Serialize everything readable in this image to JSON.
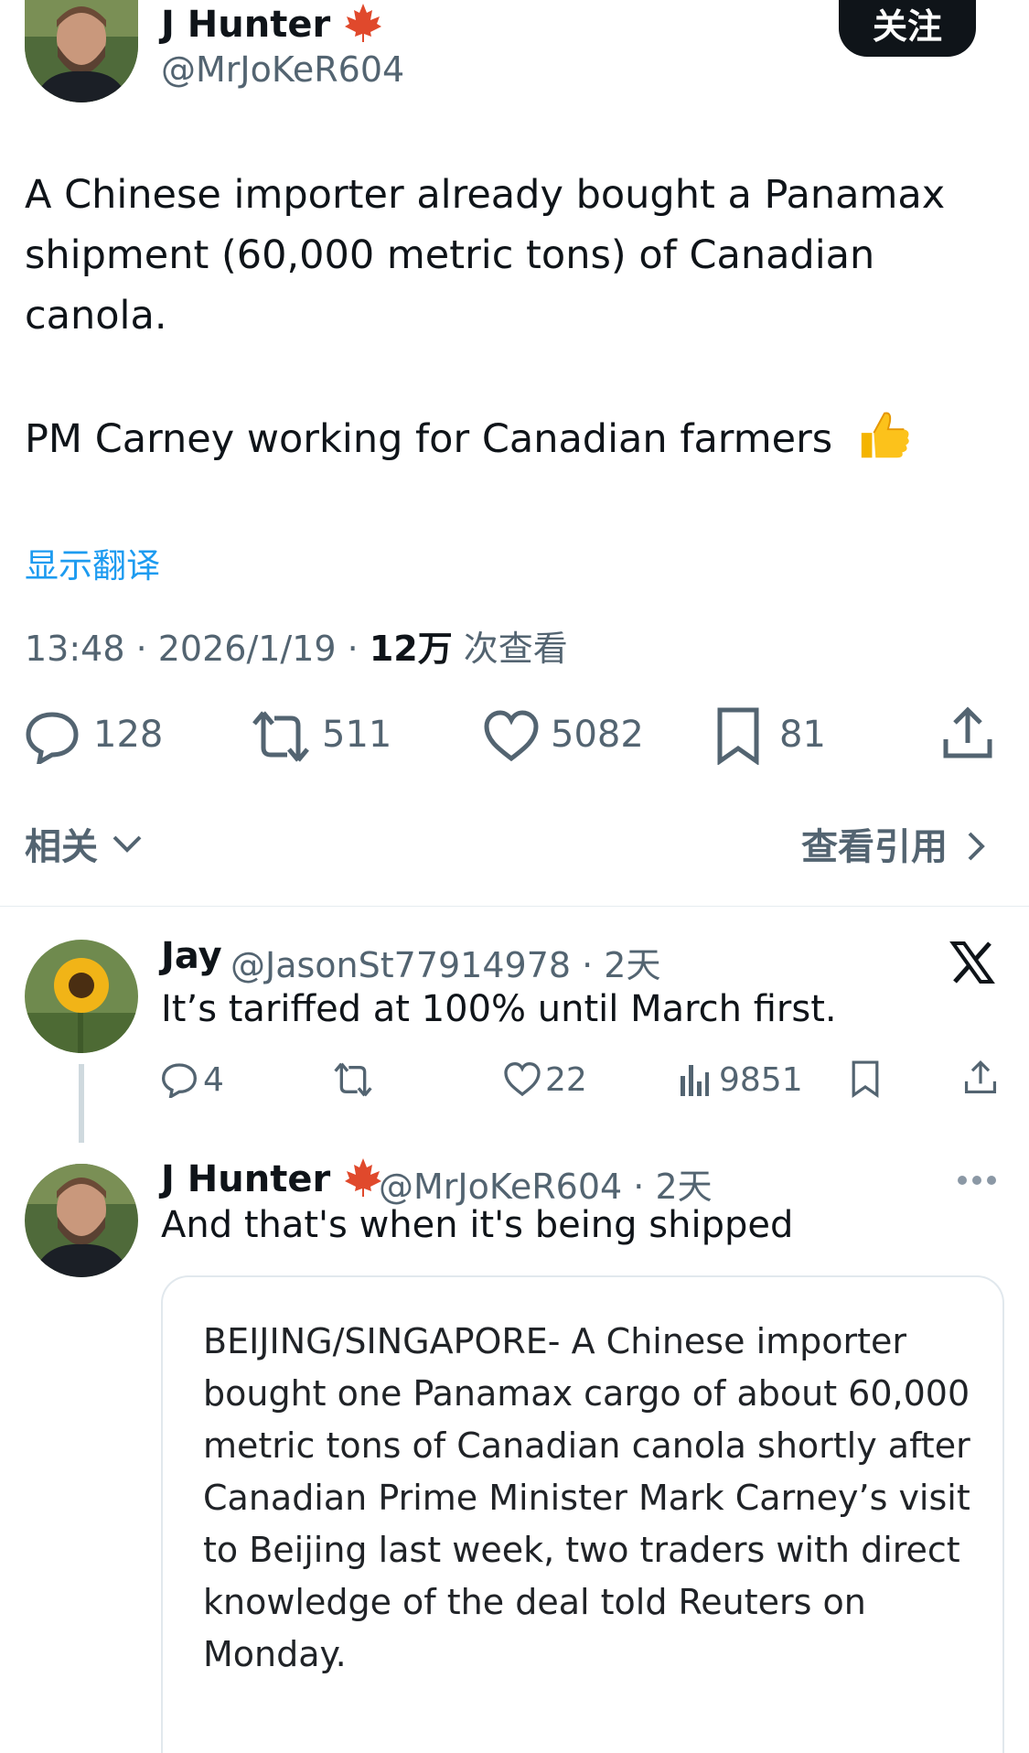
{
  "main_tweet": {
    "author_name": "J Hunter",
    "author_handle": "@MrJoKeR604",
    "follow_label": "关注",
    "text_line1": "A Chinese importer already bought a Panamax",
    "text_line2": "shipment (60,000 metric tons) of Canadian",
    "text_line3": "canola.",
    "text_line4": "PM Carney working for Canadian farmers",
    "translate_label": "显示翻译",
    "time": "13:48 · 2026/1/19 · ",
    "views_count": "12万",
    "views_label": " 次查看",
    "stats": {
      "replies": "128",
      "reposts": "511",
      "likes": "5082",
      "bookmarks": "81"
    },
    "related_label": "相关",
    "quotes_label": "查看引用"
  },
  "reply": {
    "author_name": "Jay",
    "meta": "@JasonSt77914978 · 2天",
    "text": "It’s tariffed at 100% until March first.",
    "stats": {
      "replies": "4",
      "likes": "22",
      "views": "9851"
    }
  },
  "nested_reply": {
    "author_name": "J Hunter",
    "meta": "@MrJoKeR604 · 2天",
    "text": "And that's when it's being shipped",
    "card_lines": [
      "BEIJING/SINGAPORE- A Chinese importer",
      "bought one Panamax cargo of about 60,000",
      "metric tons of Canadian canola shortly after",
      "Canadian Prime Minister Mark Carney’s visit",
      "to Beijing last week, two traders with direct",
      "knowledge of the deal told Reuters on",
      "Monday."
    ]
  },
  "colors": {
    "link": "#1d9bf0",
    "text": "#0f1419",
    "muted": "#536471",
    "maple": "#e0492c"
  }
}
